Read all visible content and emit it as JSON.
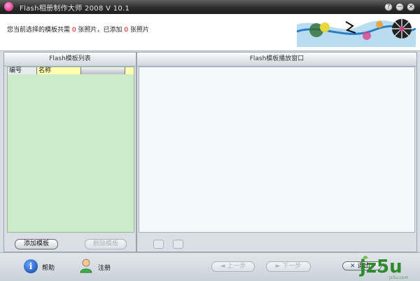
{
  "window": {
    "title": "Flash相册制作大师 2008 V 10.1",
    "controls": {
      "help": "?",
      "minimize": "−",
      "close": "×"
    }
  },
  "header": {
    "prefix": "您当前选择的模板共需",
    "required_count": "0",
    "mid": "张照片，已添加",
    "added_count": "0",
    "suffix": "张照片"
  },
  "template_list": {
    "title": "Flash模板列表",
    "columns": [
      "编号",
      "名称",
      "",
      ""
    ],
    "add_button": "添加模板",
    "delete_button": "删除模板"
  },
  "player": {
    "title": "Flash模板播放窗口"
  },
  "footer": {
    "help_label": "帮助",
    "register_label": "注册",
    "prev_button": "上一步",
    "next_button": "下一步",
    "exit_button": "退出"
  },
  "watermark": {
    "text": "jz5u",
    "sub": "jz5u.com"
  }
}
